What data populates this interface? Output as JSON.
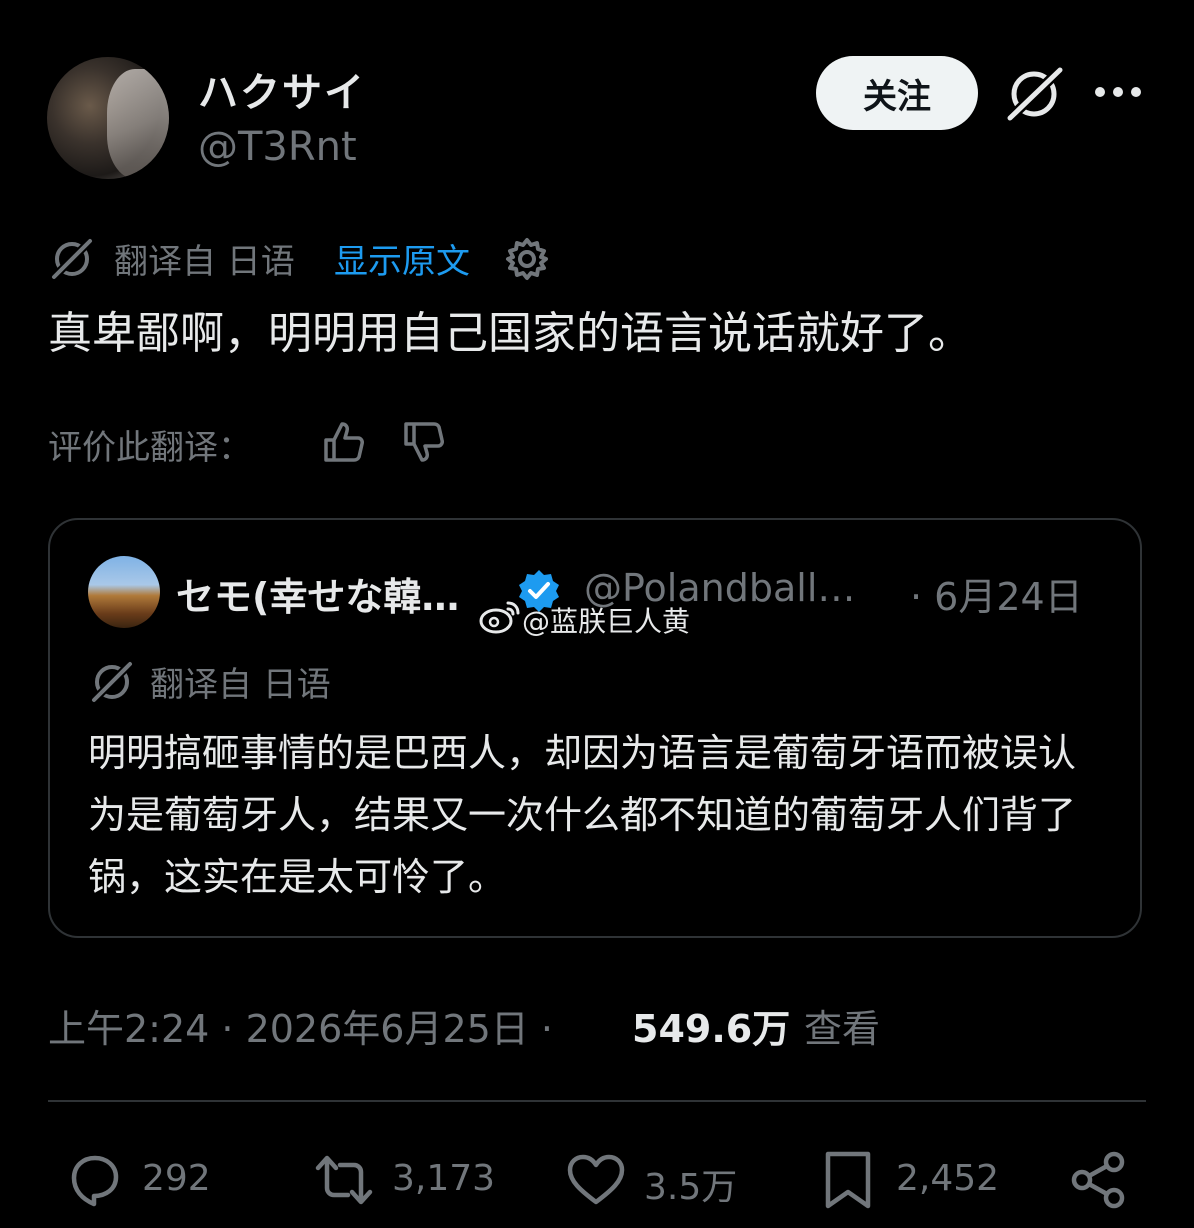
{
  "author": {
    "display_name": "ハクサイ",
    "handle": "@T3Rnt"
  },
  "header": {
    "follow_label": "关注"
  },
  "translation": {
    "label": "翻译自 日语",
    "show_original": "显示原文"
  },
  "post_text": "真卑鄙啊，明明用自己国家的语言说话就好了。",
  "rate": {
    "label": "评价此翻译："
  },
  "quote": {
    "display_name": "セモ(幸せな韓…",
    "handle": "@Polandball…",
    "date": "· 6月24日",
    "translation_label": "翻译自 日语",
    "text": "明明搞砸事情的是巴西人，却因为语言是葡萄牙语而被误认为是葡萄牙人，结果又一次什么都不知道的葡萄牙人们背了锅，这实在是太可怜了。"
  },
  "watermark": "@蓝朕巨人黄",
  "meta": {
    "time": "上午2:24 · 2026年6月25日 ·",
    "views": "549.6万",
    "views_label": "查看"
  },
  "actions": {
    "replies": "292",
    "reposts": "3,173",
    "likes": "3.5万",
    "bookmarks": "2,452"
  },
  "colors": {
    "background": "#000000",
    "text": "#e7e9ea",
    "muted": "#71767b",
    "link": "#1d9bf0",
    "border": "#2f3336"
  }
}
